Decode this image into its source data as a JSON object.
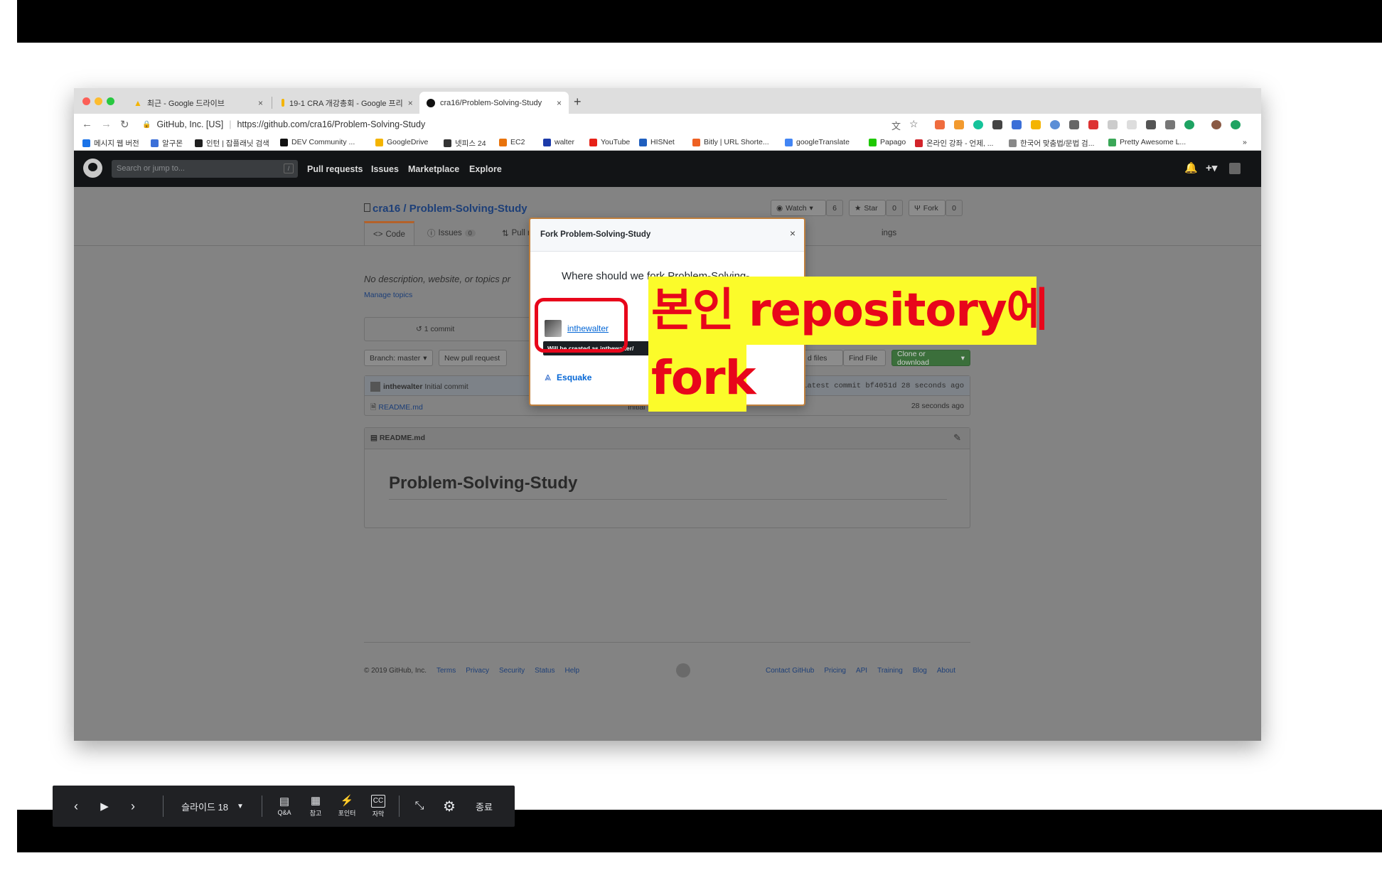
{
  "browser": {
    "tabs": [
      {
        "title": "최근 - Google 드라이브",
        "icon": "google-drive-icon"
      },
      {
        "title": "19-1 CRA 개강총회 - Google 프리",
        "icon": "google-slides-icon"
      },
      {
        "title": "cra16/Problem-Solving-Study",
        "icon": "github-icon"
      }
    ],
    "security_label": "GitHub, Inc. [US]",
    "url": "https://github.com/cra16/Problem-Solving-Study",
    "bookmarks": [
      {
        "label": "메시지 웹 버전",
        "color": "#1a73e8"
      },
      {
        "label": "알구몬",
        "color": "#3b6fd8"
      },
      {
        "label": "인턴 | 잡플래닛 검색",
        "color": "#1f1f1f"
      },
      {
        "label": "DEV Community ...",
        "color": "#111111"
      },
      {
        "label": "GoogleDrive",
        "color": "#f4b400"
      },
      {
        "label": "넷피스 24",
        "color": "#333333"
      },
      {
        "label": "EC2",
        "color": "#e8730c"
      },
      {
        "label": "walter",
        "color": "#1c3aa9"
      },
      {
        "label": "YouTube",
        "color": "#e62117"
      },
      {
        "label": "HISNet",
        "color": "#1f5fbf"
      },
      {
        "label": "Bitly | URL Shorte...",
        "color": "#ee6123"
      },
      {
        "label": "googleTranslate",
        "color": "#4285f4"
      },
      {
        "label": "Papago",
        "color": "#1ec800"
      },
      {
        "label": "온라인 강좌 - 언제, ...",
        "color": "#d2232a"
      },
      {
        "label": "한국어 맞춤법/문법 검...",
        "color": "#888888"
      },
      {
        "label": "Pretty Awesome L...",
        "color": "#3aa757"
      }
    ],
    "bookmarks_more": "»"
  },
  "github": {
    "search_placeholder": "Search or jump to...",
    "search_shortcut": "/",
    "nav": [
      "Pull requests",
      "Issues",
      "Marketplace",
      "Explore"
    ],
    "repo_owner": "cra16",
    "repo_sep": "/",
    "repo_name": "Problem-Solving-Study",
    "watch_label": "Watch",
    "watch_count": "6",
    "star_label": "Star",
    "star_count": "0",
    "fork_label": "Fork",
    "fork_count": "0",
    "tabs": {
      "code": "Code",
      "issues": "Issues",
      "issues_count": "0",
      "pulls": "Pull re",
      "settings": "ings"
    },
    "description": "No description, website, or topics pr",
    "manage_topics": "Manage topics",
    "commits": "1 commit",
    "branch_label": "Branch: master",
    "new_pr": "New pull request",
    "upload_files": "d files",
    "find_file": "Find File",
    "clone": "Clone or download",
    "commit_author": "inthewalter",
    "commit_msg": "Initial commit",
    "latest_commit": "Latest commit bf4051d 28 seconds ago",
    "file_name": "README.md",
    "file_msg": "Initial",
    "file_time": "28 seconds ago",
    "readme_header": "README.md",
    "readme_title": "Problem-Solving-Study",
    "footer_left": [
      "© 2019 GitHub, Inc.",
      "Terms",
      "Privacy",
      "Security",
      "Status",
      "Help"
    ],
    "footer_right": [
      "Contact GitHub",
      "Pricing",
      "API",
      "Training",
      "Blog",
      "About"
    ]
  },
  "modal": {
    "title": "Fork Problem-Solving-Study",
    "close": "×",
    "question": "Where should we fork Problem-Solving-",
    "option1": "inthewalter",
    "tooltip": "Will be created as inthewalter/",
    "option2": "Esquake"
  },
  "annotation": {
    "line1": "본인 repository에",
    "line2": "fork",
    "color": "#e8061b",
    "highlight": "#fbfb2a"
  },
  "slides_bar": {
    "slide_label": "슬라이드 18",
    "qa": "Q&A",
    "notes": "참고",
    "pointer": "포인터",
    "captions": "자막",
    "end": "종료"
  }
}
